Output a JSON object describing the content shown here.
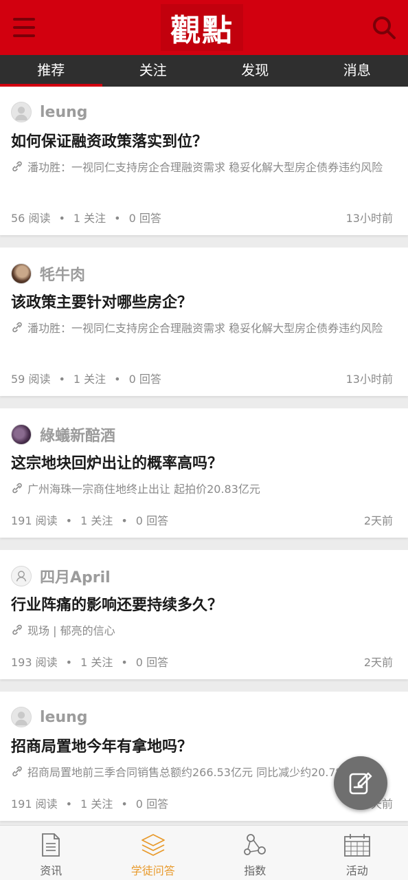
{
  "header": {
    "logo_text": "觀點",
    "menu_icon": "menu-icon",
    "search_icon": "search-icon"
  },
  "tabs": [
    {
      "label": "推荐",
      "active": true
    },
    {
      "label": "关注",
      "active": false
    },
    {
      "label": "发现",
      "active": false
    },
    {
      "label": "消息",
      "active": false
    }
  ],
  "cards": [
    {
      "author": "leung",
      "avatar": "default",
      "title": "如何保证融资政策落实到位？",
      "link_text": "潘功胜：一视同仁支持房企合理融资需求 稳妥化解大型房企债券违约风险",
      "reads": "56 阅读",
      "follows": "1 关注",
      "answers": "0 回答",
      "time": "13小时前"
    },
    {
      "author": "牦牛肉",
      "avatar": "photo",
      "title": "该政策主要针对哪些房企？",
      "link_text": "潘功胜：一视同仁支持房企合理融资需求 稳妥化解大型房企债券违约风险",
      "reads": "59 阅读",
      "follows": "1 关注",
      "answers": "0 回答",
      "time": "13小时前"
    },
    {
      "author": "綠蟻新醅酒",
      "avatar": "photo2",
      "title": "这宗地块回炉出让的概率高吗？",
      "link_text": "广州海珠一宗商住地终止出让 起拍价20.83亿元",
      "reads": "191 阅读",
      "follows": "1 关注",
      "answers": "0 回答",
      "time": "2天前"
    },
    {
      "author": "四月April",
      "avatar": "outline",
      "title": "行业阵痛的影响还要持续多久？",
      "link_text": "现场 | 郁亮的信心",
      "reads": "193 阅读",
      "follows": "1 关注",
      "answers": "0 回答",
      "time": "2天前"
    },
    {
      "author": "leung",
      "avatar": "default",
      "title": "招商局置地今年有拿地吗？",
      "link_text": "招商局置地前三季合同销售总额约266.53亿元 同比减少约20.7%",
      "reads": "191 阅读",
      "follows": "1 关注",
      "answers": "0 回答",
      "time": "2天前"
    }
  ],
  "fab": {
    "icon": "compose-icon"
  },
  "bottom_nav": [
    {
      "label": "资讯",
      "icon": "document-icon",
      "active": false
    },
    {
      "label": "学徒问答",
      "icon": "layers-icon",
      "active": true
    },
    {
      "label": "指数",
      "icon": "network-icon",
      "active": false
    },
    {
      "label": "活动",
      "icon": "calendar-icon",
      "active": false
    }
  ],
  "colors": {
    "brand_red": "#d2000f",
    "tab_bar": "#2f2f2f",
    "active_nav": "#e89a2c"
  }
}
